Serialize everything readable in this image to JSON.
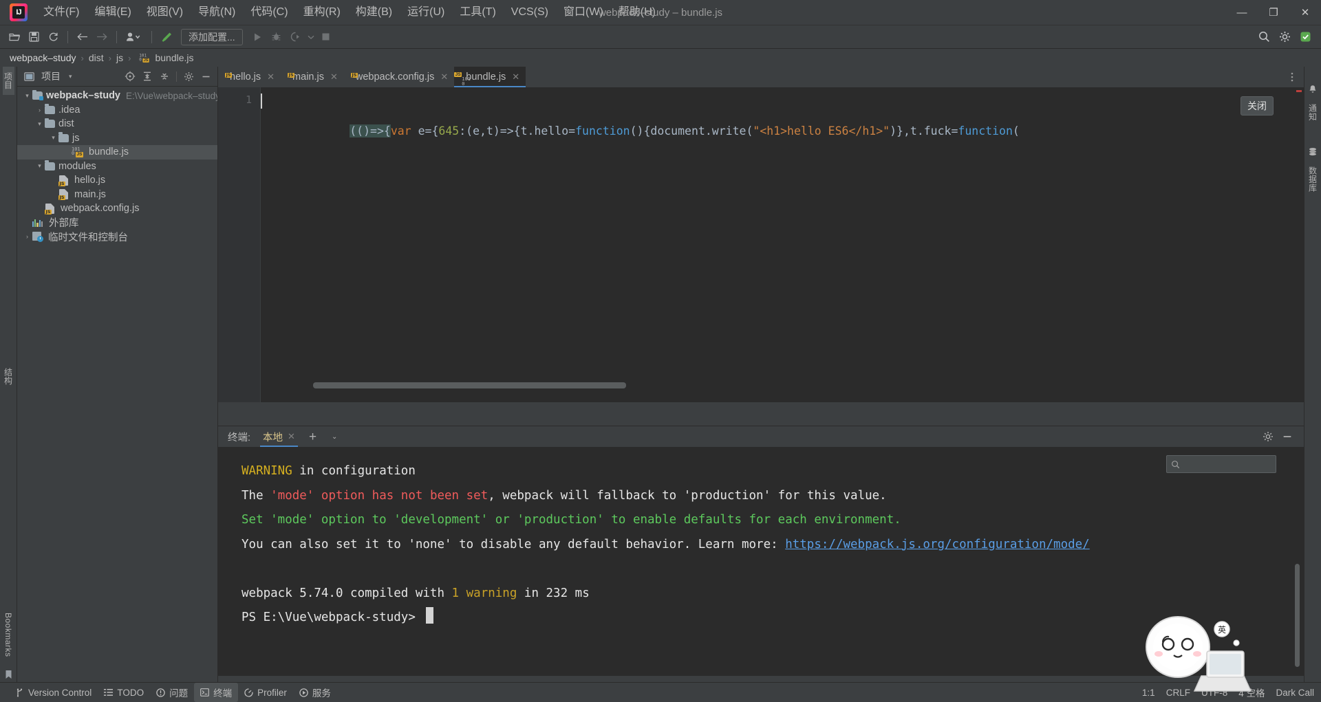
{
  "window": {
    "title": "webpack–study – bundle.js",
    "minimize_label": "—",
    "maximize_label": "❐",
    "close_label": "✕"
  },
  "menubar": {
    "logo_text": "IJ",
    "items": [
      {
        "label": "文件(F)",
        "name": "menu-file"
      },
      {
        "label": "编辑(E)",
        "name": "menu-edit"
      },
      {
        "label": "视图(V)",
        "name": "menu-view"
      },
      {
        "label": "导航(N)",
        "name": "menu-navigate"
      },
      {
        "label": "代码(C)",
        "name": "menu-code"
      },
      {
        "label": "重构(R)",
        "name": "menu-refactor"
      },
      {
        "label": "构建(B)",
        "name": "menu-build"
      },
      {
        "label": "运行(U)",
        "name": "menu-run"
      },
      {
        "label": "工具(T)",
        "name": "menu-tools"
      },
      {
        "label": "VCS(S)",
        "name": "menu-vcs"
      },
      {
        "label": "窗口(W)",
        "name": "menu-window"
      },
      {
        "label": "帮助(H)",
        "name": "menu-help"
      }
    ]
  },
  "toolbar": {
    "open_icon": "open-folder-icon",
    "save_icon": "save-icon",
    "sync_icon": "refresh-icon",
    "back_icon": "arrow-left-icon",
    "forward_icon": "arrow-right-icon",
    "profile_icon": "user-switch-icon",
    "build_icon": "hammer-icon",
    "add_config_label": "添加配置...",
    "run_icon": "run-triangle-icon",
    "debug_icon": "debug-bug-icon",
    "coverage_icon": "run-coverage-icon",
    "more_run_icon": "chevron-down-icon",
    "stop_icon": "stop-square-icon",
    "search_icon": "search-icon",
    "settings_icon": "gear-icon",
    "updates_icon": "idea-update-icon"
  },
  "breadcrumb": {
    "separator": "›",
    "items": [
      {
        "label": "webpack–study",
        "name": "breadcrumb-project"
      },
      {
        "label": "dist",
        "name": "breadcrumb-dist"
      },
      {
        "label": "js",
        "name": "breadcrumb-js"
      },
      {
        "label": "bundle.js",
        "name": "breadcrumb-bundle"
      }
    ]
  },
  "left_rail": {
    "project_tab": "项目",
    "structure_tab": "结构",
    "bookmarks_tab": "Bookmarks",
    "bookmark_icon": "bookmark-icon"
  },
  "right_rail": {
    "notifications_tab": "通知",
    "database_tab": "数据库",
    "bell_icon": "bell-icon",
    "database_icon": "database-icon"
  },
  "project_panel": {
    "title": "项目",
    "caret": "▾",
    "icons": {
      "locate": "crosshair-target-icon",
      "expand_all": "expand-all-icon",
      "collapse_all": "collapse-all-icon",
      "settings": "gear-icon",
      "hide": "minimize-icon"
    },
    "tree": [
      {
        "label": "webpack–study",
        "path": "E:\\Vue\\webpack–study",
        "icon": "module-folder-icon",
        "indent": 0,
        "twisty": "expanded",
        "bold": true,
        "selected": false
      },
      {
        "label": ".idea",
        "path": "",
        "icon": "folder-icon",
        "indent": 1,
        "twisty": "collapsed",
        "bold": false,
        "selected": false
      },
      {
        "label": "dist",
        "path": "",
        "icon": "folder-icon",
        "indent": 1,
        "twisty": "expanded",
        "bold": false,
        "selected": false
      },
      {
        "label": "js",
        "path": "",
        "icon": "folder-icon",
        "indent": 2,
        "twisty": "expanded",
        "bold": false,
        "selected": false
      },
      {
        "label": "bundle.js",
        "path": "",
        "icon": "bundle-js-icon",
        "indent": 3,
        "twisty": "none",
        "bold": false,
        "selected": true
      },
      {
        "label": "modules",
        "path": "",
        "icon": "folder-icon",
        "indent": 1,
        "twisty": "expanded",
        "bold": false,
        "selected": false
      },
      {
        "label": "hello.js",
        "path": "",
        "icon": "js-file-icon",
        "indent": 2,
        "twisty": "none",
        "bold": false,
        "selected": false
      },
      {
        "label": "main.js",
        "path": "",
        "icon": "js-file-icon",
        "indent": 2,
        "twisty": "none",
        "bold": false,
        "selected": false
      },
      {
        "label": "webpack.config.js",
        "path": "",
        "icon": "js-file-icon",
        "indent": 1,
        "twisty": "none",
        "bold": false,
        "selected": false
      },
      {
        "label": "外部库",
        "path": "",
        "icon": "external-libraries-icon",
        "indent": 0,
        "twisty": "none",
        "bold": false,
        "selected": false
      },
      {
        "label": "临时文件和控制台",
        "path": "",
        "icon": "scratches-consoles-icon",
        "indent": 0,
        "twisty": "collapsed",
        "bold": false,
        "selected": false
      }
    ]
  },
  "editor": {
    "tabs": [
      {
        "label": "hello.js",
        "icon": "js-file-icon",
        "active": false,
        "close": "✕"
      },
      {
        "label": "main.js",
        "icon": "js-file-icon",
        "active": false,
        "close": "✕"
      },
      {
        "label": "webpack.config.js",
        "icon": "js-file-icon",
        "active": false,
        "close": "✕"
      },
      {
        "label": "bundle.js",
        "icon": "bundle-js-icon",
        "active": true,
        "close": "✕"
      }
    ],
    "options_icon": "more-options-icon",
    "line_number": "1",
    "code_tokens": [
      {
        "t": "(()=>{",
        "c": "p"
      },
      {
        "t": "var",
        "c": "kw"
      },
      {
        "t": " e={",
        "c": "p"
      },
      {
        "t": "645",
        "c": "num"
      },
      {
        "t": ":(e,t)=>{t.hello=",
        "c": "p"
      },
      {
        "t": "function",
        "c": "fn"
      },
      {
        "t": "(){document.write(",
        "c": "p"
      },
      {
        "t": "\"<h1>hello ES6</h1>\"",
        "c": "str"
      },
      {
        "t": ")},t.fuck=",
        "c": "p"
      },
      {
        "t": "function",
        "c": "fn"
      },
      {
        "t": "(",
        "c": "p"
      }
    ],
    "code_plain": "(()=>{var e={645:(e,t)=>{t.hello=function(){document.write(\"<h1>hello ES6</h1>\")},t.fuck=function(",
    "tooltip": "关闭"
  },
  "terminal": {
    "header_label": "终端:",
    "tab_label": "本地",
    "tab_close": "✕",
    "add_label": "+",
    "dropdown_label": "⌄",
    "settings_icon": "gear-icon",
    "hide_icon": "minimize-icon",
    "search_placeholder": "",
    "search_icon": "search-icon",
    "lines": [
      [
        {
          "t": "WARNING",
          "c": "yellow"
        },
        {
          "t": " in configuration",
          "c": "white"
        }
      ],
      [
        {
          "t": "The ",
          "c": "white"
        },
        {
          "t": "'mode' option has not been set",
          "c": "red"
        },
        {
          "t": ", webpack will fallback to 'production' for this value.",
          "c": "white"
        }
      ],
      [
        {
          "t": "Set 'mode' option to 'development' or 'production' to enable defaults for each environment.",
          "c": "green"
        }
      ],
      [
        {
          "t": "You can also set it to 'none' to disable any default behavior. Learn more: ",
          "c": "white"
        },
        {
          "t": "https://webpack.js.org/configuration/mode/",
          "c": "link"
        }
      ],
      [
        {
          "t": "",
          "c": "white"
        }
      ],
      [
        {
          "t": "webpack 5.74.0 compiled with ",
          "c": "white"
        },
        {
          "t": "1 warning",
          "c": "amber"
        },
        {
          "t": " in 232 ms",
          "c": "white"
        }
      ],
      [
        {
          "t": "PS E:\\Vue\\webpack-study> ",
          "c": "white"
        }
      ]
    ]
  },
  "statusbar": {
    "items": [
      {
        "label": "Version Control",
        "icon": "branch-icon",
        "name": "status-version-control",
        "active": false
      },
      {
        "label": "TODO",
        "icon": "todo-list-icon",
        "name": "status-todo",
        "active": false
      },
      {
        "label": "问题",
        "icon": "problems-icon",
        "name": "status-problems",
        "active": false
      },
      {
        "label": "终端",
        "icon": "terminal-icon",
        "name": "status-terminal",
        "active": true
      },
      {
        "label": "Profiler",
        "icon": "profiler-icon",
        "name": "status-profiler",
        "active": false
      },
      {
        "label": "服务",
        "icon": "services-icon",
        "name": "status-services",
        "active": false
      }
    ],
    "caret_position": "1:1",
    "line_separator": "CRLF",
    "encoding": "UTF-8",
    "indent": "4 空格",
    "theme_hint": "Dark Call"
  },
  "colors": {
    "accent": "#4a88c7",
    "panel_bg": "#3c3f41",
    "editor_bg": "#2b2b2b",
    "selection": "#4e5254",
    "warning": "#d6b020",
    "error": "#f05b5b",
    "success": "#5dc95d"
  }
}
